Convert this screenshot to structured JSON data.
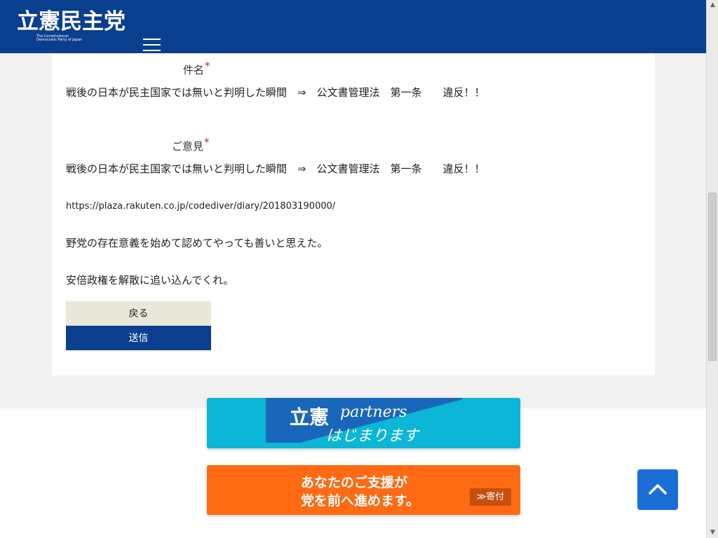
{
  "header": {
    "logo_text": "立憲民主党",
    "logo_sub_1": "The Constitutional",
    "logo_sub_2": "Democratic Party of Japan"
  },
  "form": {
    "subject_label": "件名",
    "subject_value": "戦後の日本が民主国家では無いと判明した瞬間　⇒　公文書管理法　第一条　　違反！！",
    "opinion_label": "ご意見",
    "opinion_line1": "戦後の日本が民主国家では無いと判明した瞬間　⇒　公文書管理法　第一条　　違反！！",
    "opinion_url": "https://plaza.rakuten.co.jp/codediver/diary/201803190000/",
    "opinion_line2": "野党の存在意義を始めて認めてやっても善いと思えた。",
    "opinion_line3": "安倍政権を解散に追い込んでくれ。",
    "required_mark": "*",
    "back_label": "戻る",
    "send_label": "送信"
  },
  "banners": {
    "partners_main": "立憲",
    "partners_script": "partners",
    "partners_sub": "はじまります",
    "donate_line1": "あなたのご支援が",
    "donate_line2": "党を前へ進めます。",
    "donate_button": "≫寄付"
  },
  "colors": {
    "header_bg": "#0a3f8f",
    "send_bg": "#0a3f8f",
    "back_bg": "#e9e7d9",
    "partners_bg": "#0bb6d6",
    "donate_bg": "#ff6a13",
    "to_top_bg": "#1a6fd6"
  },
  "icons": {
    "menu": "hamburger-menu-icon",
    "to_top": "chevron-up-icon"
  }
}
